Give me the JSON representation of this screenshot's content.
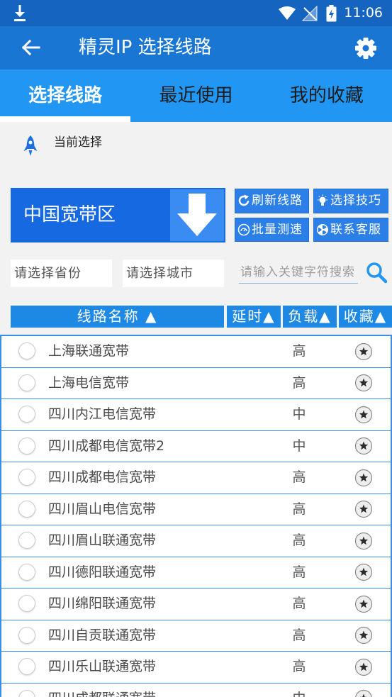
{
  "status_bar": {
    "time": "11:06",
    "icons": [
      "download-icon",
      "wifi-icon",
      "no-sim-signal-icon",
      "battery-charging-icon"
    ]
  },
  "app_bar": {
    "title": "精灵IP 选择线路",
    "back_icon": "back-arrow-icon",
    "settings_icon": "gear-icon"
  },
  "tabs": [
    {
      "label": "选择线路",
      "active": true
    },
    {
      "label": "最近使用",
      "active": false
    },
    {
      "label": "我的收藏",
      "active": false
    }
  ],
  "current_selection": {
    "icon": "rocket-icon",
    "label": "当前选择",
    "region": "中国宽带区",
    "region_dropdown_icon": "down-arrow-icon"
  },
  "actions": [
    {
      "label": "刷新线路",
      "icon": "refresh-icon"
    },
    {
      "label": "选择技巧",
      "icon": "lightbulb-icon"
    },
    {
      "label": "批量测速",
      "icon": "speed-test-icon"
    },
    {
      "label": "联系客服",
      "icon": "customer-service-icon"
    }
  ],
  "filters": {
    "province": "请选择省份",
    "city": "请选择城市",
    "search_placeholder": "请输入关键字符搜索",
    "search_icon": "search-icon"
  },
  "table": {
    "headers": {
      "name": "线路名称 ▲",
      "latency": "延时▲",
      "load": "负载▲",
      "favorite": "收藏▲"
    },
    "row_icons": {
      "select": "radio-icon",
      "favorite": "star-icon"
    },
    "rows": [
      {
        "name": "上海联通宽带",
        "load": "高"
      },
      {
        "name": "上海电信宽带",
        "load": "高"
      },
      {
        "name": "四川内江电信宽带",
        "load": "中"
      },
      {
        "name": "四川成都电信宽带2",
        "load": "中"
      },
      {
        "name": "四川成都电信宽带",
        "load": "高"
      },
      {
        "name": "四川眉山电信宽带",
        "load": "高"
      },
      {
        "name": "四川眉山联通宽带",
        "load": "高"
      },
      {
        "name": "四川德阳联通宽带",
        "load": "高"
      },
      {
        "name": "四川绵阳联通宽带",
        "load": "高"
      },
      {
        "name": "四川自贡联通宽带",
        "load": "高"
      },
      {
        "name": "四川乐山联通宽带",
        "load": "高"
      },
      {
        "name": "四川成都联通宽带",
        "load": "中"
      }
    ]
  },
  "colors": {
    "status_bar": "#1565c0",
    "app_bar": "#1976d2",
    "tab_bar": "#2196f3",
    "accent": "#1e88e5",
    "background": "#f2f2f2"
  }
}
